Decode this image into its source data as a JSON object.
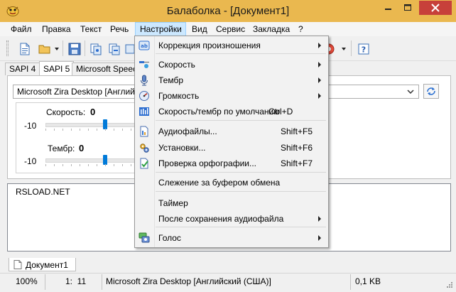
{
  "window": {
    "title": "Балаболка - [Документ1]"
  },
  "menubar": {
    "items": [
      "Файл",
      "Правка",
      "Текст",
      "Речь",
      "Настройки",
      "Вид",
      "Сервис",
      "Закладка",
      "?"
    ]
  },
  "tabs": {
    "engines": [
      "SAPI 4",
      "SAPI 5",
      "Microsoft Speech"
    ]
  },
  "voice": {
    "selected": "Microsoft Zira Desktop [Английский",
    "speed_label": "Скорость:",
    "speed_value": "0",
    "speed_min": "-10",
    "pitch_label": "Тембр:",
    "pitch_value": "0",
    "pitch_min": "-10",
    "speed_level": 0,
    "pitch_level": 0
  },
  "editor": {
    "text": "RSLOAD.NET"
  },
  "doc_tabs": [
    "Документ1"
  ],
  "statusbar": {
    "zoom": "100%",
    "position": "1:  11",
    "voice": "Microsoft Zira Desktop [Английский (США)]",
    "size": "0,1 KB"
  },
  "settings_menu": {
    "items": [
      {
        "icon": "pronunciation-icon",
        "label": "Коррекция произношения",
        "shortcut": "",
        "submenu": true
      },
      {
        "icon": "speed-icon",
        "label": "Скорость",
        "shortcut": "",
        "submenu": true
      },
      {
        "icon": "microphone-icon",
        "label": "Тембр",
        "shortcut": "",
        "submenu": true
      },
      {
        "icon": "volume-icon",
        "label": "Громкость",
        "shortcut": "",
        "submenu": true
      },
      {
        "icon": "equalizer-icon",
        "label": "Скорость/тембр по умолчанию",
        "shortcut": "Ctrl+D",
        "submenu": false
      },
      {
        "icon": "audio-files-icon",
        "label": "Аудиофайлы...",
        "shortcut": "Shift+F5",
        "submenu": false
      },
      {
        "icon": "settings-gears-icon",
        "label": "Установки...",
        "shortcut": "Shift+F6",
        "submenu": false
      },
      {
        "icon": "spellcheck-icon",
        "label": "Проверка орфографии...",
        "shortcut": "Shift+F7",
        "submenu": false
      },
      {
        "icon": "",
        "label": "Слежение за буфером обмена",
        "shortcut": "",
        "submenu": false
      },
      {
        "icon": "",
        "label": "Таймер",
        "shortcut": "",
        "submenu": false
      },
      {
        "icon": "",
        "label": "После сохранения аудиофайла",
        "shortcut": "",
        "submenu": true
      },
      {
        "icon": "voice-icon",
        "label": "Голос",
        "shortcut": "",
        "submenu": true
      }
    ]
  },
  "colors": {
    "titlebar": "#eab84f",
    "close_button": "#c7403a",
    "menu_highlight": "#cce8ff",
    "slider_thumb": "#007ad9"
  }
}
